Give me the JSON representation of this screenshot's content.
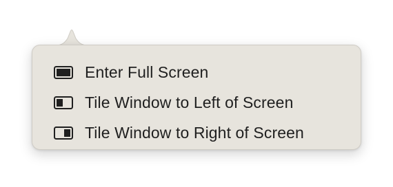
{
  "popover": {
    "items": [
      {
        "label": "Enter Full Screen",
        "icon": "full-screen-icon"
      },
      {
        "label": "Tile Window to Left of Screen",
        "icon": "tile-left-icon"
      },
      {
        "label": "Tile Window to Right of Screen",
        "icon": "tile-right-icon"
      }
    ]
  },
  "colors": {
    "popover_background": "#e7e4dd",
    "text": "#1f1f1f",
    "icon": "#1f1f1f"
  }
}
